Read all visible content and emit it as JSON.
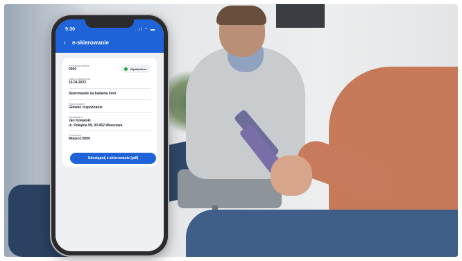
{
  "status_bar": {
    "time": "9:30",
    "icons": "..ıl ⌔ ▬"
  },
  "header": {
    "back_glyph": "‹",
    "title": "e-skierowanie"
  },
  "referral": {
    "code_label": "Kod skierowania",
    "code_value": "0000",
    "status": "Wystawione",
    "status_color": "#2aa33a",
    "date_label": "Data wystawienia",
    "date_value": "16.04.2023",
    "type_value": "Skierowanie na badania krwi",
    "diagnosis_label": "Rozpoznanie",
    "diagnosis_value": "Główne rozpoznanie",
    "issuer_label": "Wystawił/-a",
    "issuer_name": "Jan Kowalski",
    "issuer_address": "ul. Pokątna 99, 00-952 Warszawa",
    "procedures_label": "Procedury",
    "procedures_value": "Miejsce:0000"
  },
  "actions": {
    "share_label": "Udostępnij e-skierowanie (pdf)"
  },
  "colors": {
    "accent": "#1f63d8",
    "screen_bg": "#eef0f4"
  }
}
